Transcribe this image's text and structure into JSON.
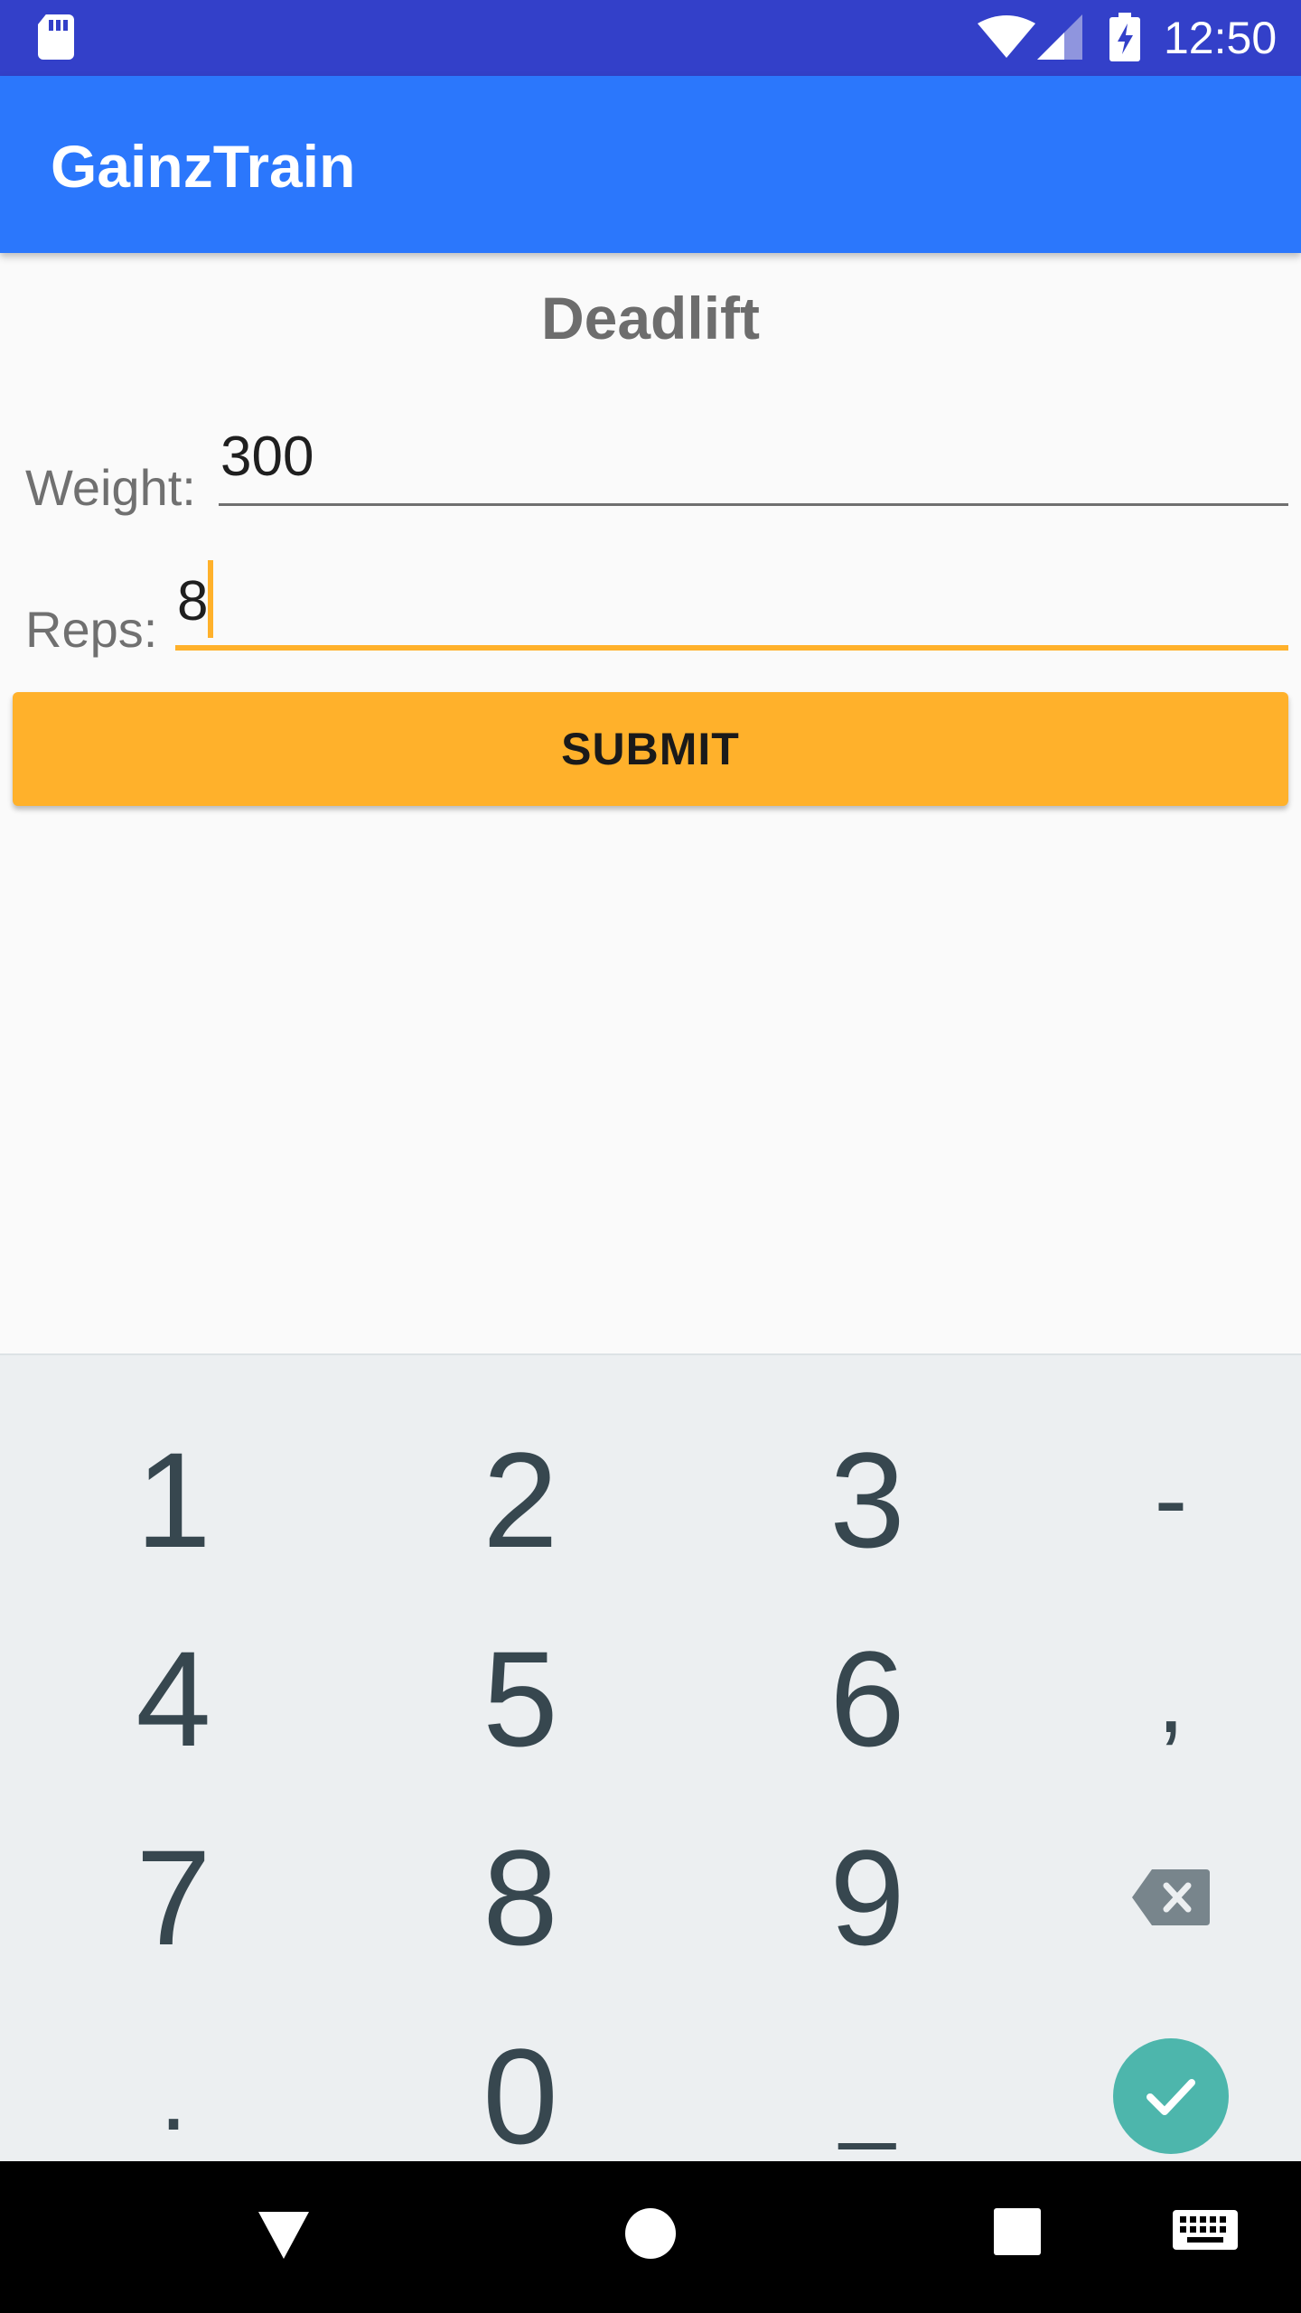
{
  "status_bar": {
    "time": "12:50",
    "icons": [
      "sd-card-icon",
      "wifi-icon",
      "signal-icon",
      "battery-charging-icon"
    ]
  },
  "app_bar": {
    "title": "GainzTrain"
  },
  "exercise": {
    "name": "Deadlift"
  },
  "form": {
    "weight": {
      "label": "Weight:",
      "value": "300"
    },
    "reps": {
      "label": "Reps:",
      "value": "8"
    },
    "submit_label": "SUBMIT"
  },
  "keyboard": {
    "rows": [
      [
        "1",
        "2",
        "3",
        "-"
      ],
      [
        "4",
        "5",
        "6",
        ","
      ],
      [
        "7",
        "8",
        "9",
        "backspace"
      ],
      [
        ".",
        "0",
        "_",
        "done"
      ]
    ]
  },
  "nav_bar": {
    "icons": [
      "back-icon",
      "home-icon",
      "recents-icon",
      "keyboard-switch-icon"
    ]
  },
  "colors": {
    "status_bar": "#3340c9",
    "app_bar": "#2b77fc",
    "accent": "#ffb12b",
    "keyboard_bg": "#eceff1",
    "done_button": "#4db6ac"
  }
}
